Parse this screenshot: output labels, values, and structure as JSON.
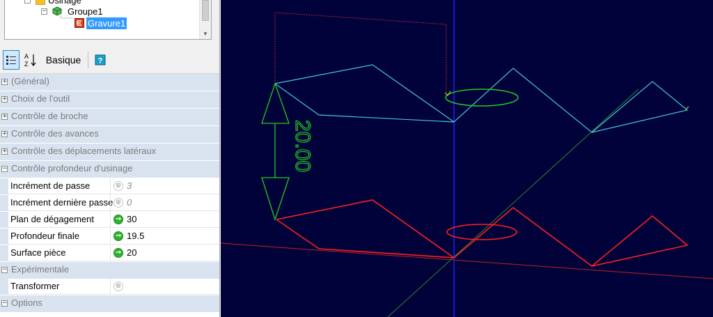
{
  "tree": {
    "items": [
      {
        "label": "Usinage"
      },
      {
        "label": "Groupe1"
      },
      {
        "label": "Gravure1"
      }
    ]
  },
  "toolbar": {
    "categorized_icon": "categorized-icon",
    "alpha_label": "A↓Z",
    "basic_label": "Basique",
    "help_label": "?"
  },
  "grid": {
    "categories": [
      {
        "label": "(Général)",
        "state": "+"
      },
      {
        "label": "Choix de l'outil",
        "state": "+"
      },
      {
        "label": "Contrôle de broche",
        "state": "+"
      },
      {
        "label": "Contrôle des avances",
        "state": "+"
      },
      {
        "label": "Contrôle des déplacements latéraux",
        "state": "+"
      },
      {
        "label": "Contrôle profondeur d'usinage",
        "state": "−"
      },
      {
        "label": "Expérimentale",
        "state": "−"
      },
      {
        "label": "Options",
        "state": "−"
      }
    ],
    "depth_props": [
      {
        "name": "Incrément de passe",
        "value": "3",
        "enabled": false
      },
      {
        "name": "Incrément dernière passe",
        "value": "0",
        "enabled": false
      },
      {
        "name": "Plan de dégagement",
        "value": "30",
        "enabled": true
      },
      {
        "name": "Profondeur finale",
        "value": "19.5",
        "enabled": true
      },
      {
        "name": "Surface pièce",
        "value": "20",
        "enabled": true
      }
    ],
    "exp_props": [
      {
        "name": "Transformer",
        "value": "",
        "enabled": false
      }
    ]
  },
  "viewport": {
    "dimension_label": "20.00",
    "colors": {
      "background": "#02023a",
      "upper_outline": "#40c8e0",
      "lower_outline": "#ff2020",
      "dimension": "#22cc22",
      "clearance": "#e03030",
      "axis_blue": "#2020ff",
      "axis_red": "#c02020",
      "axis_green": "#2a8a2a"
    }
  }
}
